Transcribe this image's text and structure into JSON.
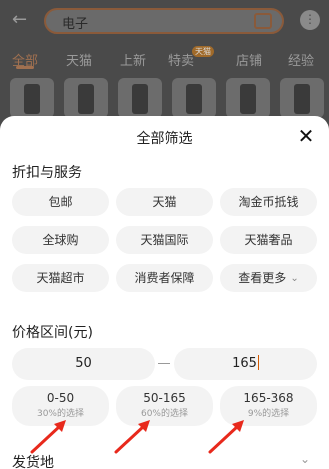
{
  "background": {
    "search_text": "电子",
    "tabs": [
      "全部",
      "天猫",
      "上新",
      "特卖",
      "店铺",
      "经验"
    ],
    "tab_badge": "天猫",
    "more_icon": "more-dots-icon"
  },
  "sheet": {
    "title": "全部筛选",
    "discount_section": {
      "title": "折扣与服务",
      "chips": [
        "包邮",
        "天猫",
        "淘金币抵钱",
        "全球购",
        "天猫国际",
        "天猫奢品",
        "天猫超市",
        "消费者保障",
        "查看更多"
      ]
    },
    "price_section": {
      "title": "价格区间(元)",
      "min_value": "50",
      "max_value": "165",
      "ranges": [
        {
          "range": "0-50",
          "pct": "30%的选择"
        },
        {
          "range": "50-165",
          "pct": "60%的选择"
        },
        {
          "range": "165-368",
          "pct": "9%的选择"
        }
      ]
    },
    "ship_section": {
      "title": "发货地"
    },
    "annotation_color": "#e8291c"
  }
}
